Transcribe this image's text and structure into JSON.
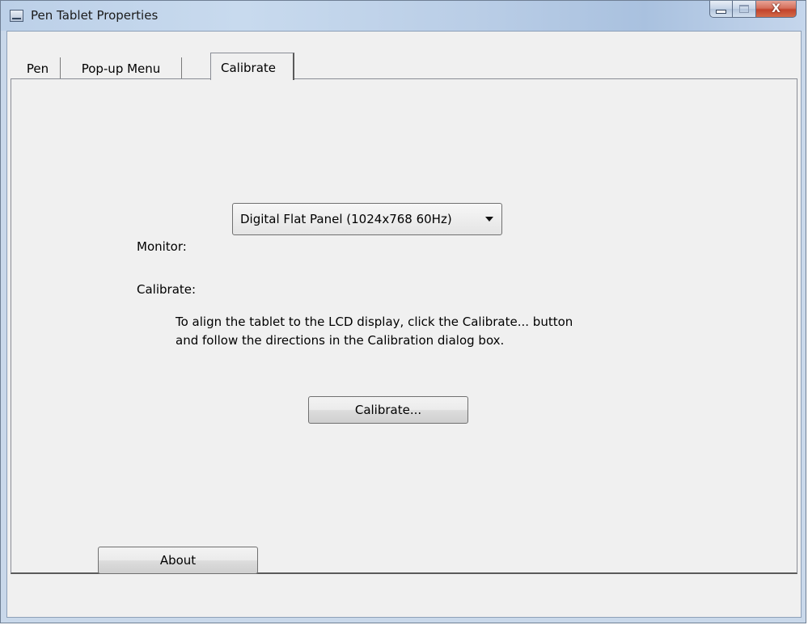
{
  "window": {
    "title": "Pen Tablet Properties",
    "close_glyph": "X"
  },
  "tabs": [
    {
      "label": "Pen",
      "selected": false
    },
    {
      "label": "Pop-up Menu",
      "selected": false
    },
    {
      "label": "Calibrate",
      "selected": true
    }
  ],
  "calibrate_tab": {
    "monitor_label": "Monitor:",
    "monitor_value": "Digital Flat Panel (1024x768 60Hz)",
    "calibrate_label": "Calibrate:",
    "instruction_line1": "To align the tablet to the LCD display, click the Calibrate... button",
    "instruction_line2": "and follow the directions in the Calibration dialog box.",
    "calibrate_button": "Calibrate..."
  },
  "footer": {
    "about_button": "About"
  },
  "colors": {
    "client_bg": "#f0f0f0",
    "close_button": "#c2432c",
    "frame": "#c9d8ea"
  },
  "icons": [
    "window-app-icon",
    "minimize-icon",
    "maximize-icon",
    "close-icon",
    "dropdown-arrow-icon"
  ]
}
